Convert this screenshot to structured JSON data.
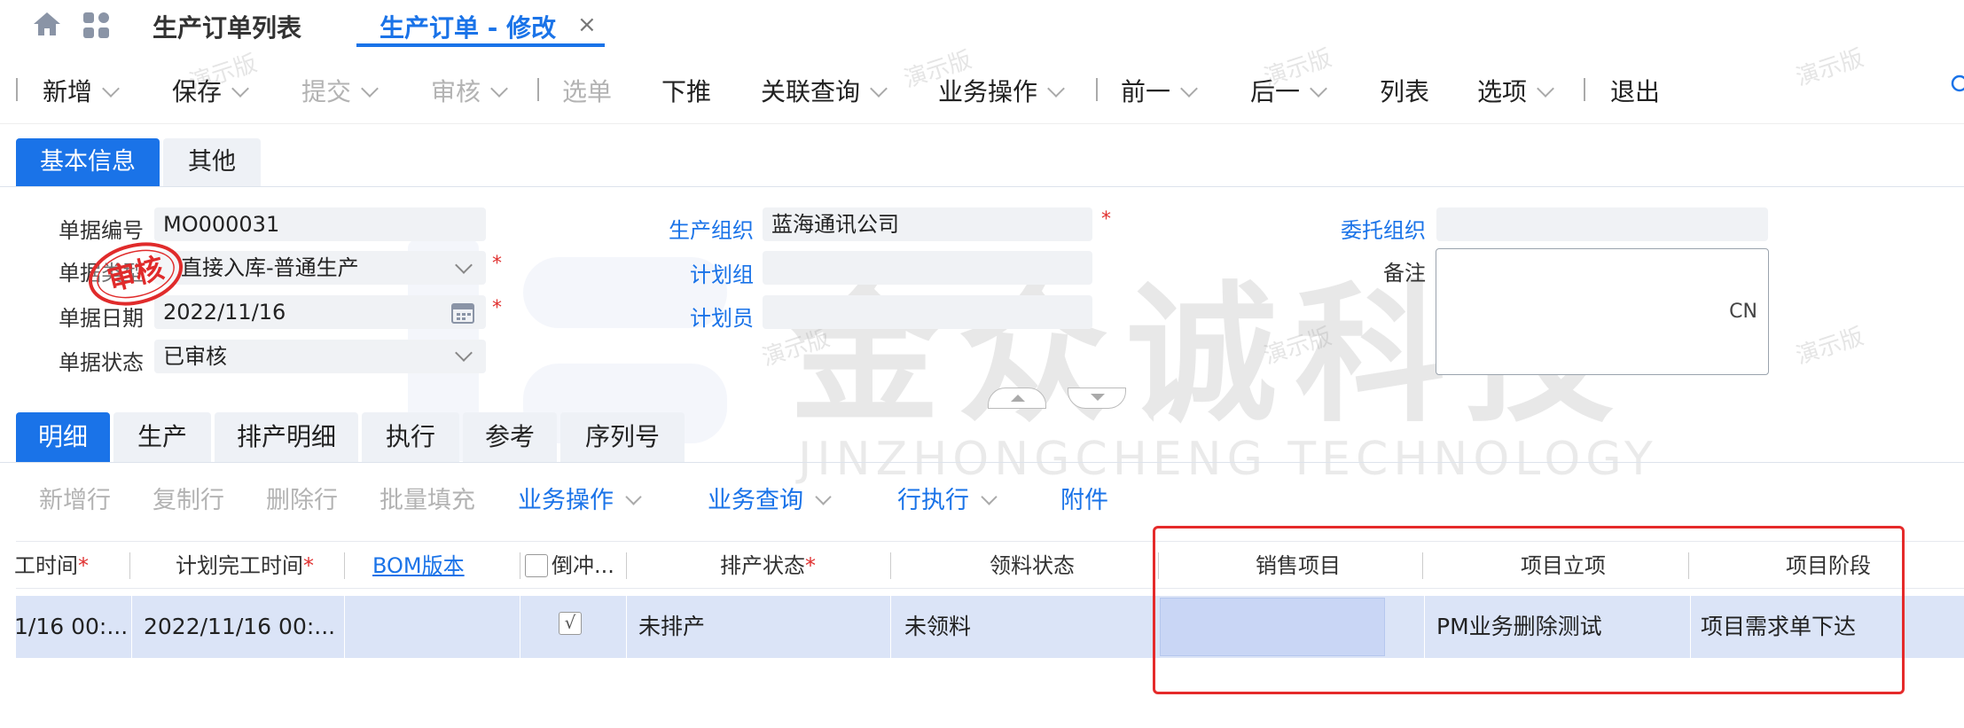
{
  "top_tabs": {
    "list_label": "生产订单列表",
    "edit_label": "生产订单 - 修改",
    "close_glyph": "×"
  },
  "toolbar": [
    {
      "label": "新增",
      "disabled": false,
      "caret": true
    },
    {
      "label": "保存",
      "disabled": false,
      "caret": true
    },
    {
      "label": "提交",
      "disabled": true,
      "caret": true
    },
    {
      "label": "审核",
      "disabled": true,
      "caret": true
    },
    {
      "label": "选单",
      "disabled": true,
      "caret": false
    },
    {
      "label": "下推",
      "disabled": false,
      "caret": false
    },
    {
      "label": "关联查询",
      "disabled": false,
      "caret": true
    },
    {
      "label": "业务操作",
      "disabled": false,
      "caret": true
    },
    {
      "label": "前一",
      "disabled": false,
      "caret": true
    },
    {
      "label": "后一",
      "disabled": false,
      "caret": true
    },
    {
      "label": "列表",
      "disabled": false,
      "caret": false
    },
    {
      "label": "选项",
      "disabled": false,
      "caret": true
    },
    {
      "label": "退出",
      "disabled": false,
      "caret": false
    }
  ],
  "section_tabs": [
    "基本信息",
    "其他"
  ],
  "form": {
    "bill_no_label": "单据编号",
    "bill_no": "MO000031",
    "bill_type_label": "单据类型",
    "bill_type": "直接入库-普通生产",
    "bill_date_label": "单据日期",
    "bill_date": "2022/11/16",
    "bill_status_label": "单据状态",
    "bill_status": "已审核",
    "prod_org_label": "生产组织",
    "prod_org": "蓝海通讯公司",
    "plan_group_label": "计划组",
    "plan_group": "",
    "planner_label": "计划员",
    "planner": "",
    "entrust_org_label": "委托组织",
    "entrust_org": "",
    "note_label": "备注",
    "note_lang": "CN"
  },
  "stamp_text": "审核",
  "watermark": {
    "cn": "金众诚科技",
    "en": "JINZHONGCHENG TECHNOLOGY",
    "demo": "演示版"
  },
  "detail_tabs": [
    "明细",
    "生产",
    "排产明细",
    "执行",
    "参考",
    "序列号"
  ],
  "detail_toolbar": [
    {
      "label": "新增行",
      "blue": false,
      "caret": false
    },
    {
      "label": "复制行",
      "blue": false,
      "caret": false
    },
    {
      "label": "删除行",
      "blue": false,
      "caret": false
    },
    {
      "label": "批量填充",
      "blue": false,
      "caret": false
    },
    {
      "label": "业务操作",
      "blue": true,
      "caret": true
    },
    {
      "label": "业务查询",
      "blue": true,
      "caret": true
    },
    {
      "label": "行执行",
      "blue": true,
      "caret": true
    },
    {
      "label": "附件",
      "blue": true,
      "caret": false
    }
  ],
  "grid": {
    "headers": {
      "start_time": "工时间",
      "plan_finish": "计划完工时间",
      "bom": "BOM版本",
      "backflush": "倒冲...",
      "sched_status": "排产状态",
      "pick_status": "领料状态",
      "sales_project": "销售项目",
      "project_setup": "项目立项",
      "project_stage": "项目阶段"
    },
    "row": {
      "start_time": "1/16 00:...",
      "plan_finish": "2022/11/16 00:...",
      "bom": "",
      "backflush_check": "√",
      "sched_status": "未排产",
      "pick_status": "未领料",
      "sales_project": "",
      "project_setup": "PM业务删除测试",
      "project_stage": "项目需求单下达"
    }
  },
  "colors": {
    "accent": "#1a73e8",
    "required": "#e0302f",
    "highlight": "#e52a2a",
    "row_bg": "#dbe4f7"
  }
}
